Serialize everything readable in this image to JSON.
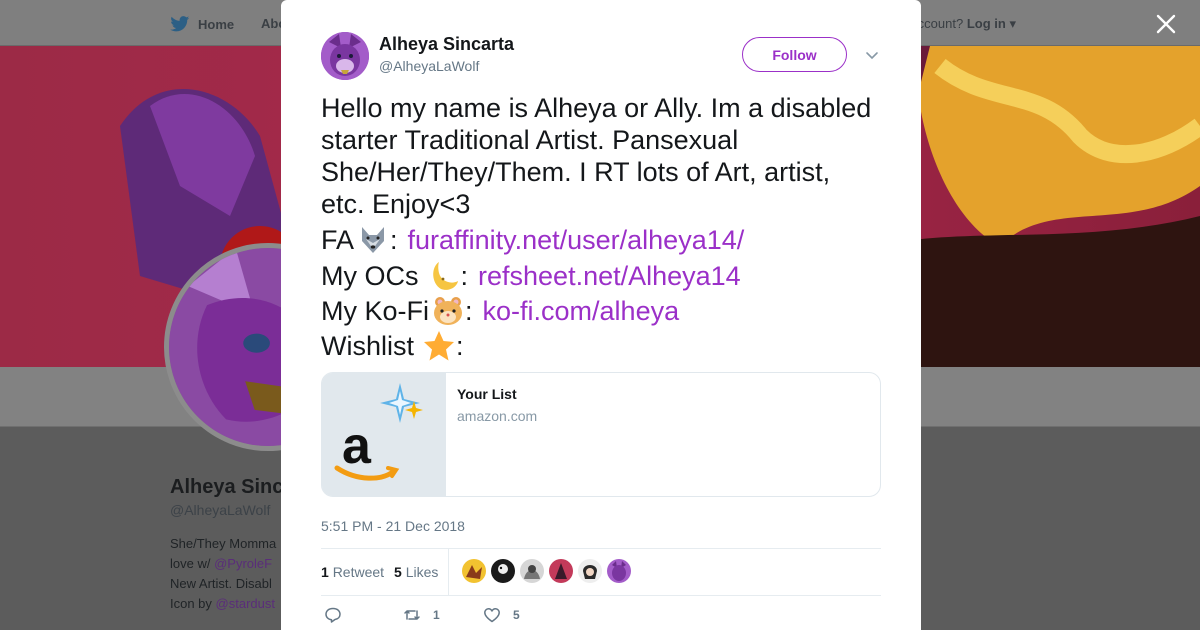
{
  "background": {
    "nav": {
      "home_label": "Home",
      "about_label": "Abo",
      "account_prompt": "ccount?",
      "login_label": "Log in"
    },
    "profile": {
      "name": "Alheya Sinc",
      "handle": "@AlheyaLaWolf",
      "bio_lines": [
        "She/They Momma",
        "love w/ ",
        "New Artist. Disabl",
        "Icon by "
      ],
      "bio_link_1": "@PyroleF",
      "bio_link_2": "@stardust"
    }
  },
  "modal": {
    "user": {
      "display_name": "Alheya Sincarta",
      "screen_name": "@AlheyaLaWolf"
    },
    "follow_label": "Follow",
    "tweet": {
      "text": "Hello my name is Alheya or Ally. Im a disabled starter Traditional Artist. Pansexual She/Her/They/Them. I RT lots of Art, artist, etc. Enjoy<3",
      "fa_label": "FA",
      "fa_link": "furaffinity.net/user/alheya14/",
      "ocs_label": "My OCs",
      "ocs_link": "refsheet.net/Alheya14",
      "kofi_label": "My Ko-Fi",
      "kofi_link": "ko-fi.com/alheya",
      "wishlist_label": "Wishlist",
      "colon": ":"
    },
    "card": {
      "title": "Your List",
      "domain": "amazon.com"
    },
    "timestamp": "5:51 PM - 21 Dec 2018",
    "stats": {
      "retweets_count": "1",
      "retweets_label": "Retweet",
      "likes_count": "5",
      "likes_label": "Likes"
    },
    "actions": {
      "retweet_count": "1",
      "like_count": "5"
    }
  },
  "colors": {
    "accent": "#9b30c8",
    "secondary_text": "#657786",
    "border": "#e1e8ed"
  }
}
